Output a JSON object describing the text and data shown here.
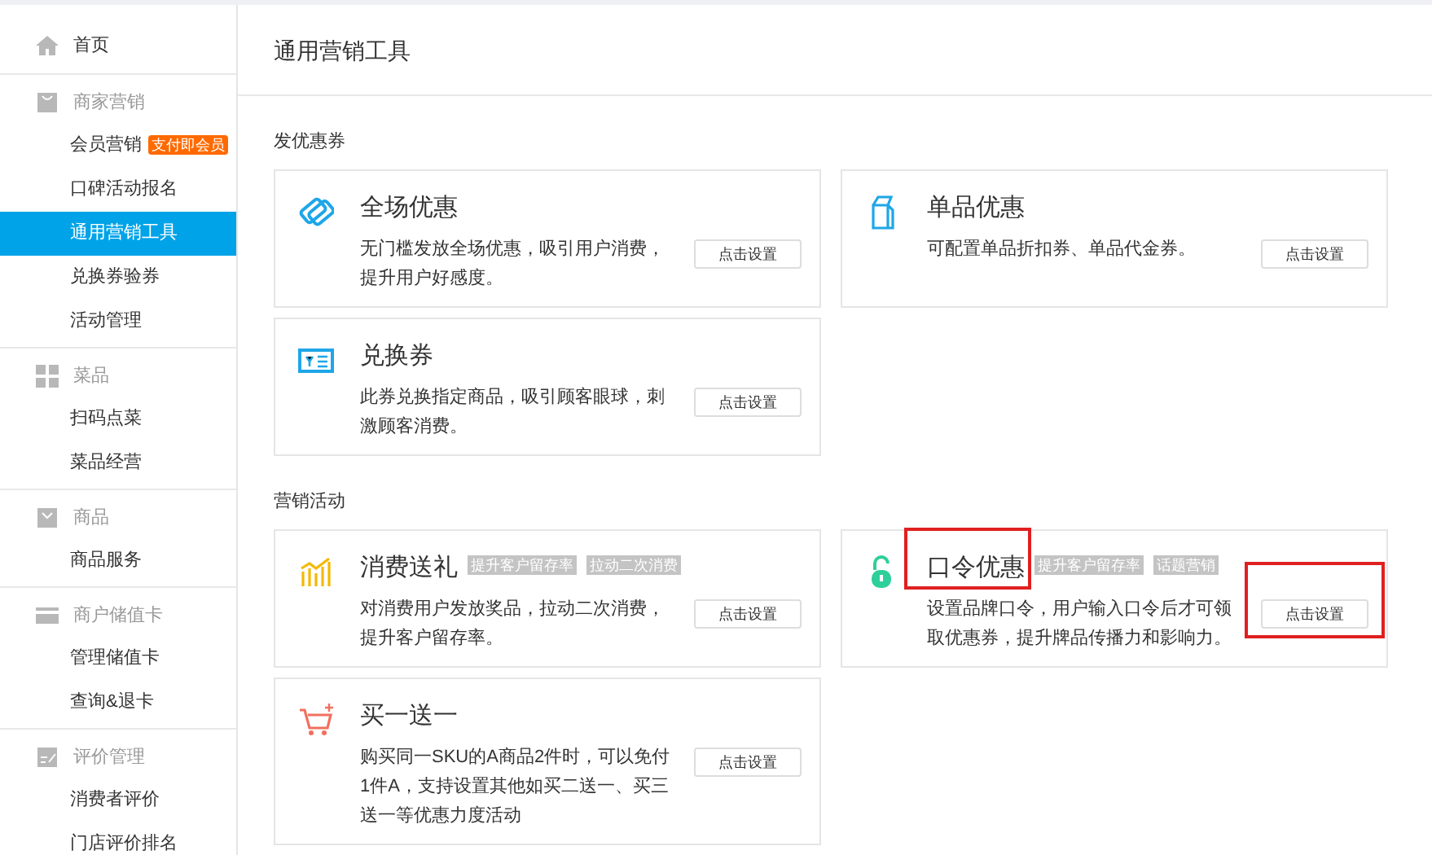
{
  "sidebar": [
    {
      "kind": "link",
      "label": "首页",
      "selected": false
    },
    {
      "kind": "group",
      "label": "商家营销",
      "children": [
        {
          "label": "会员营销",
          "badge": "支付即会员",
          "selected": false
        },
        {
          "label": "口碑活动报名",
          "selected": false
        },
        {
          "label": "通用营销工具",
          "selected": true
        },
        {
          "label": "兑换券验券",
          "selected": false
        },
        {
          "label": "活动管理",
          "selected": false
        }
      ]
    },
    {
      "kind": "group",
      "label": "菜品",
      "children": [
        {
          "label": "扫码点菜",
          "selected": false
        },
        {
          "label": "菜品经营",
          "selected": false
        }
      ]
    },
    {
      "kind": "group",
      "label": "商品",
      "children": [
        {
          "label": "商品服务",
          "selected": false
        }
      ]
    },
    {
      "kind": "group",
      "label": "商户储值卡",
      "children": [
        {
          "label": "管理储值卡",
          "selected": false
        },
        {
          "label": "查询&退卡",
          "selected": false
        }
      ]
    },
    {
      "kind": "group",
      "label": "评价管理",
      "children": [
        {
          "label": "消费者评价",
          "selected": false
        },
        {
          "label": "门店评价排名",
          "selected": false
        }
      ]
    }
  ],
  "page_title": "通用营销工具",
  "sections": [
    {
      "title": "发优惠券",
      "cards": [
        {
          "title": "全场优惠",
          "description": "无门槛发放全场优惠，吸引用户消费，提升用户好感度。",
          "button": "点击设置"
        },
        {
          "title": "单品优惠",
          "description": "可配置单品折扣券、单品代金券。",
          "button": "点击设置"
        },
        {
          "title": "兑换券",
          "description": "此券兑换指定商品，吸引顾客眼球，刺激顾客消费。",
          "button": "点击设置"
        }
      ]
    },
    {
      "title": "营销活动",
      "cards": [
        {
          "title": "消费送礼",
          "tags": [
            "提升客户留存率",
            "拉动二次消费"
          ],
          "description": "对消费用户发放奖品，拉动二次消费，提升客户留存率。",
          "button": "点击设置"
        },
        {
          "title": "口令优惠",
          "tags": [
            "提升客户留存率",
            "话题营销"
          ],
          "description": "设置品牌口令，用户输入口令后才可领取优惠券，提升牌品传播力和影响力。",
          "button": "点击设置",
          "title_highlighted": true,
          "button_highlighted": true
        },
        {
          "title": "买一送一",
          "description": "购买同一SKU的A商品2件时，可以免付1件A，支持设置其他如买二送一、买三送一等优惠力度活动",
          "button": "点击设置"
        }
      ]
    }
  ]
}
